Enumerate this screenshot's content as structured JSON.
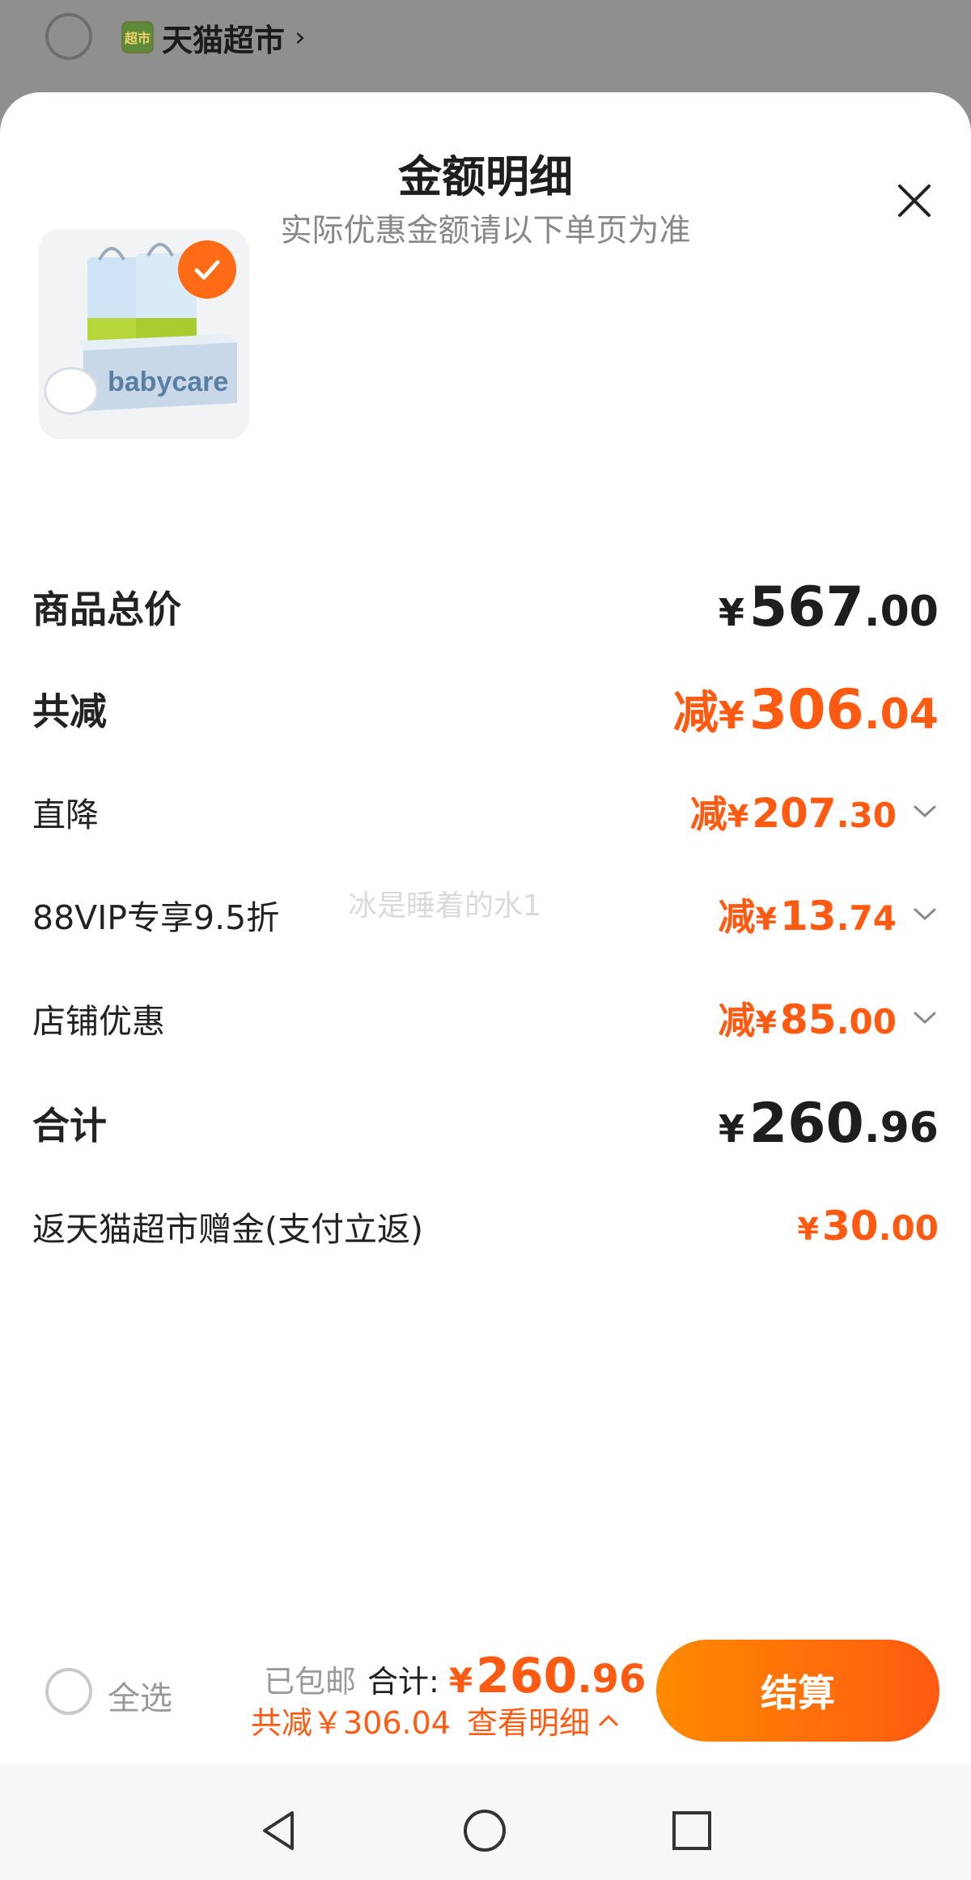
{
  "background": {
    "store_icon_text": "超市",
    "store_name": "天猫超市"
  },
  "sheet": {
    "title": "金额明细",
    "subtitle": "实际优惠金额请以下单页为准"
  },
  "product": {
    "image_label": "babycare",
    "selected": true
  },
  "rows": {
    "total_price": {
      "label": "商品总价",
      "yen": "¥",
      "int": "567",
      "dec": ".00"
    },
    "total_discount": {
      "label": "共减",
      "prefix": "减",
      "yen": "¥",
      "int": "306",
      "dec": ".04"
    },
    "direct_drop": {
      "label": "直降",
      "prefix": "减",
      "yen": "¥",
      "int": "207",
      "dec": ".30"
    },
    "vip": {
      "label": "88VIP专享9.5折",
      "prefix": "减",
      "yen": "¥",
      "int": "13",
      "dec": ".74"
    },
    "store_discount": {
      "label": "店铺优惠",
      "prefix": "减",
      "yen": "¥",
      "int": "85",
      "dec": ".00"
    },
    "subtotal": {
      "label": "合计",
      "yen": "¥",
      "int": "260",
      "dec": ".96"
    },
    "rebate": {
      "label": "返天猫超市赠金(支付立返)",
      "yen": "¥",
      "int": "30",
      "dec": ".00"
    }
  },
  "watermark": "冰是睡着的水1",
  "bottom_bar": {
    "select_all": "全选",
    "free_shipping": "已包邮",
    "sum_label": "合计:",
    "sum_yen": "¥",
    "sum_int": "260",
    "sum_dec": ".96",
    "discount_text": "共减￥306.04",
    "detail_link": "查看明细",
    "checkout": "结算"
  },
  "colors": {
    "accent": "#ff5a12",
    "accent_gradient_start": "#ff8a00",
    "text": "#1e1e1e",
    "muted": "#888888"
  },
  "icons": {
    "close": "close-icon",
    "chevron_down": "chevron-down-icon",
    "chevron_up": "chevron-up-icon",
    "check": "check-icon",
    "nav_back": "nav-back-icon",
    "nav_home": "nav-home-icon",
    "nav_recents": "nav-recents-icon"
  }
}
